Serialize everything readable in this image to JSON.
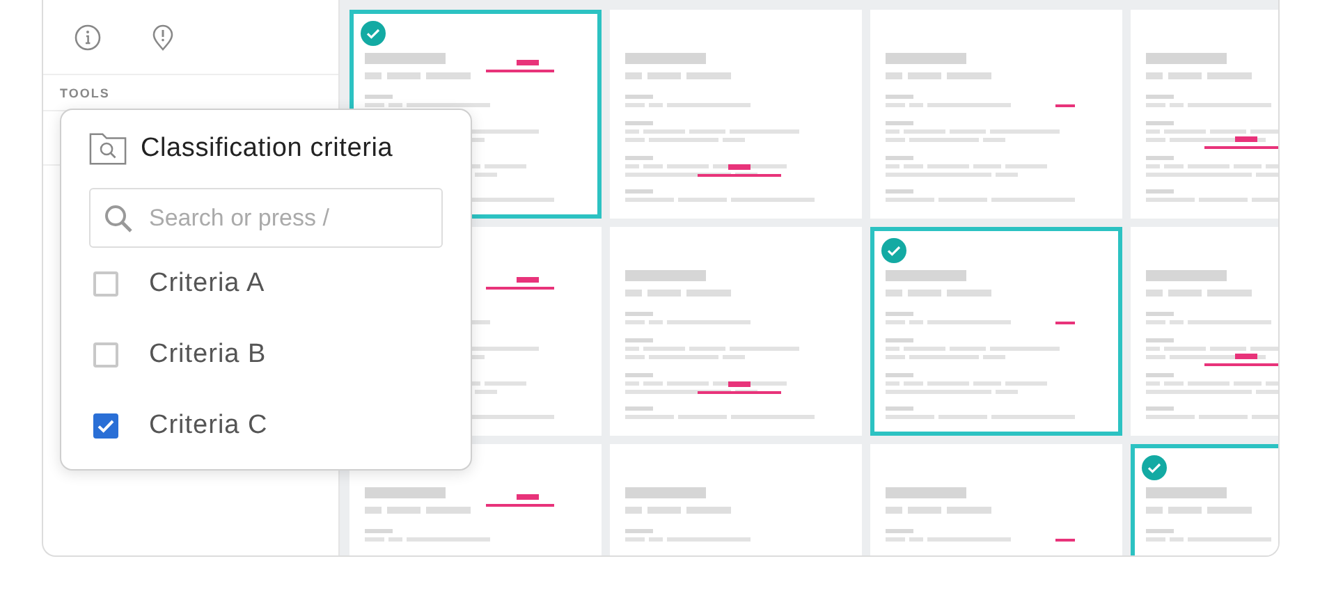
{
  "sidebar": {
    "section_label": "TOOLS"
  },
  "criteria_popup": {
    "title": "Classification criteria",
    "search": {
      "placeholder": "Search or press /"
    },
    "options": [
      {
        "label": "Criteria A",
        "checked": false
      },
      {
        "label": "Criteria B",
        "checked": false
      },
      {
        "label": "Criteria C",
        "checked": true
      }
    ]
  },
  "cards": [
    {
      "selected": true
    },
    {
      "selected": false
    },
    {
      "selected": false
    },
    {
      "selected": false
    },
    {
      "selected": false
    },
    {
      "selected": false
    },
    {
      "selected": true
    },
    {
      "selected": false
    },
    {
      "selected": false
    },
    {
      "selected": false
    },
    {
      "selected": false
    },
    {
      "selected": true
    }
  ]
}
